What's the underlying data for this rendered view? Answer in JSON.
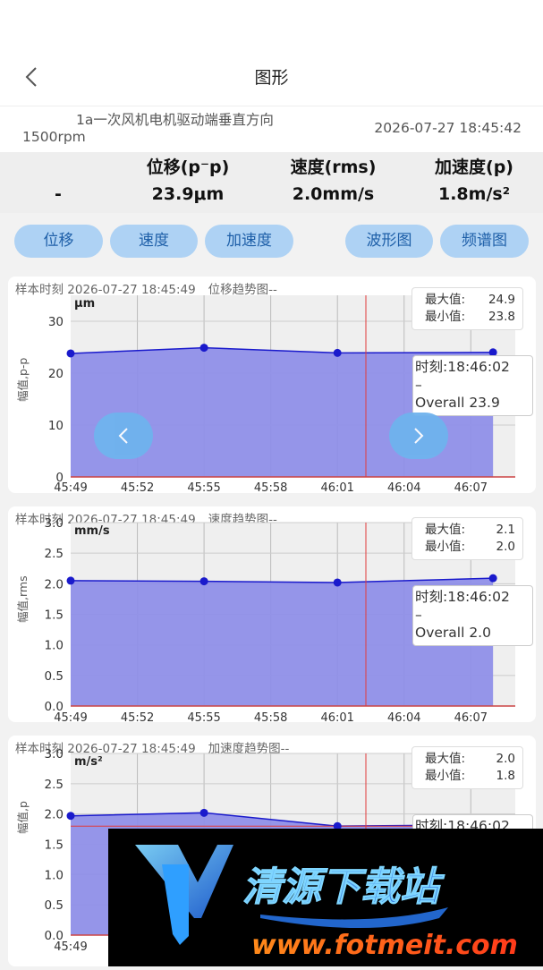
{
  "header": {
    "title": "图形"
  },
  "info": {
    "name_line1": "1a一次风机电机驱动端垂直方向",
    "name_line2": "1500rpm",
    "time": "2026-07-27 18:45:42"
  },
  "stats": {
    "headers": [
      "位移(p⁻p)",
      "速度(rms)",
      "加速度(p)"
    ],
    "values": [
      "-",
      "23.9μm",
      "2.0mm/s",
      "1.8m/s²"
    ]
  },
  "buttons": {
    "displacement": "位移",
    "velocity": "速度",
    "acceleration": "加速度",
    "waveform": "波形图",
    "spectrum": "频谱图"
  },
  "charts": [
    {
      "caption_prefix": "样本时刻 2026-07-27 18:45:49",
      "caption_title": "位移趋势图--",
      "unit": "μm",
      "ylabel": "幅值,p-p",
      "max_label": "最大值:",
      "max_value": "24.9",
      "min_label": "最小值:",
      "min_value": "23.8",
      "tip_time": "时刻:18:46:02",
      "tip_dash": "–",
      "tip_overall": "Overall 23.9"
    },
    {
      "caption_prefix": "样本时刻 2026-07-27 18:45:49",
      "caption_title": "速度趋势图--",
      "unit": "mm/s",
      "ylabel": "幅值,rms",
      "max_label": "最大值:",
      "max_value": "2.1",
      "min_label": "最小值:",
      "min_value": "2.0",
      "tip_time": "时刻:18:46:02",
      "tip_dash": "–",
      "tip_overall": "Overall 2.0"
    },
    {
      "caption_prefix": "样本时刻 2026-07-27 18:45:49",
      "caption_title": "加速度趋势图--",
      "unit": "m/s²",
      "ylabel": "幅值,p",
      "max_label": "最大值:",
      "max_value": "2.0",
      "min_label": "最小值:",
      "min_value": "1.8",
      "tip_time": "时刻:18:46:02"
    }
  ],
  "watermark": {
    "text": "清源下载站",
    "url": "www.fotmeit.com"
  },
  "colors": {
    "fill": "#8f8fe8",
    "line": "#1a1acc",
    "marker": "#e23a3a",
    "button_bg": "#aed2f4",
    "button_text": "#1e5fa8"
  },
  "chart_data": [
    {
      "type": "area",
      "x": [
        "18:45:49",
        "18:45:55",
        "18:46:01",
        "18:46:08"
      ],
      "y": [
        23.8,
        24.9,
        23.9,
        24.0
      ],
      "xticks": [
        "45:49",
        "45:52",
        "45:55",
        "45:58",
        "46:01",
        "46:04",
        "46:07"
      ],
      "yticks": [
        "0",
        "10",
        "20",
        "30"
      ],
      "ylim": [
        0,
        35
      ],
      "grid": true
    },
    {
      "type": "area",
      "x": [
        "18:45:49",
        "18:45:55",
        "18:46:01",
        "18:46:08"
      ],
      "y": [
        2.05,
        2.04,
        2.02,
        2.09
      ],
      "xticks": [
        "45:49",
        "45:52",
        "45:55",
        "45:58",
        "46:01",
        "46:04",
        "46:07"
      ],
      "yticks": [
        "0.0",
        "0.5",
        "1.0",
        "1.5",
        "2.0",
        "2.5",
        "3.0"
      ],
      "ylim": [
        0,
        3.0
      ],
      "grid": true
    },
    {
      "type": "area",
      "x": [
        "18:45:49",
        "18:45:55",
        "18:46:01",
        "18:46:08"
      ],
      "y": [
        1.97,
        2.02,
        1.8,
        1.82
      ],
      "xticks": [
        "45:49"
      ],
      "yticks": [
        "0.0",
        "0.5",
        "1.0",
        "1.5",
        "2.0",
        "2.5",
        "3.0"
      ],
      "ylim": [
        0,
        3.0
      ],
      "grid": true
    }
  ]
}
